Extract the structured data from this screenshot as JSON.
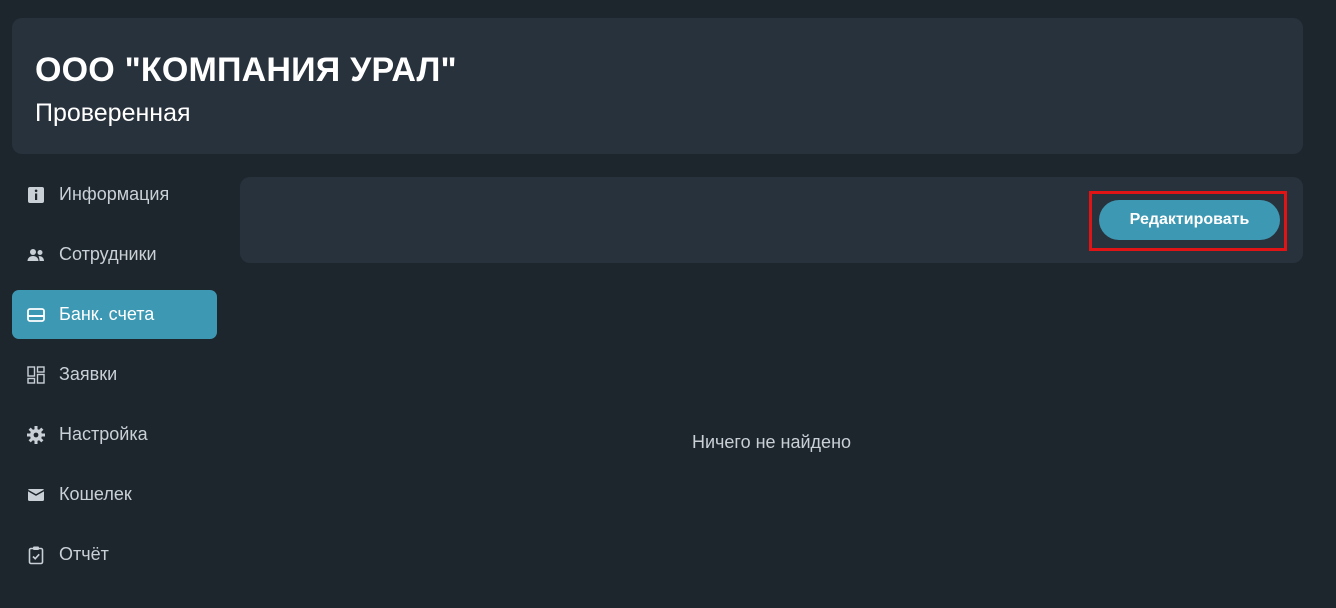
{
  "header": {
    "company_name": "ООО \"КОМПАНИЯ УРАЛ\"",
    "status": "Проверенная"
  },
  "sidebar": {
    "items": [
      {
        "label": "Информация",
        "icon": "info-icon",
        "active": false
      },
      {
        "label": "Сотрудники",
        "icon": "people-icon",
        "active": false
      },
      {
        "label": "Банк. счета",
        "icon": "card-icon",
        "active": true
      },
      {
        "label": "Заявки",
        "icon": "grid-icon",
        "active": false
      },
      {
        "label": "Настройка",
        "icon": "gear-icon",
        "active": false
      },
      {
        "label": "Кошелек",
        "icon": "wallet-icon",
        "active": false
      },
      {
        "label": "Отчёт",
        "icon": "clipboard-icon",
        "active": false
      }
    ]
  },
  "toolbar": {
    "edit_label": "Редактировать"
  },
  "main": {
    "empty_message": "Ничего не найдено"
  },
  "colors": {
    "background": "#1e262d",
    "panel": "#28323c",
    "accent": "#3d98b3",
    "highlight": "#e01414"
  }
}
